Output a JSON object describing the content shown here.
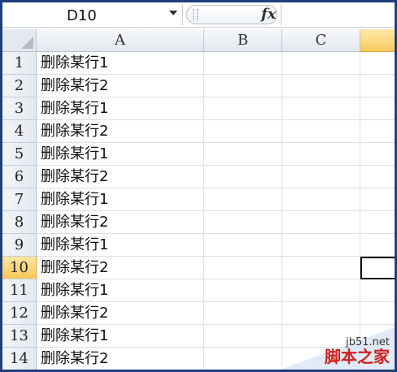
{
  "formula_bar": {
    "name_box": "D10",
    "fx_label": "fx",
    "formula": ""
  },
  "columns": [
    "A",
    "B",
    "C",
    ""
  ],
  "rows": [
    {
      "num": "1",
      "a": "删除某行1"
    },
    {
      "num": "2",
      "a": "删除某行2"
    },
    {
      "num": "3",
      "a": "删除某行1"
    },
    {
      "num": "4",
      "a": "删除某行2"
    },
    {
      "num": "5",
      "a": "删除某行1"
    },
    {
      "num": "6",
      "a": "删除某行2"
    },
    {
      "num": "7",
      "a": "删除某行1"
    },
    {
      "num": "8",
      "a": "删除某行2"
    },
    {
      "num": "9",
      "a": "删除某行1"
    },
    {
      "num": "10",
      "a": "删除某行2"
    },
    {
      "num": "11",
      "a": "删除某行1"
    },
    {
      "num": "12",
      "a": "删除某行2"
    },
    {
      "num": "13",
      "a": "删除某行1"
    },
    {
      "num": "14",
      "a": "删除某行2"
    }
  ],
  "selection": {
    "row": "10",
    "column": "D"
  },
  "watermark": {
    "site": "jb51.net",
    "name": "脚本之家"
  },
  "colors": {
    "selected_header": "#f8c95e",
    "frame": "#1f3f7a"
  }
}
